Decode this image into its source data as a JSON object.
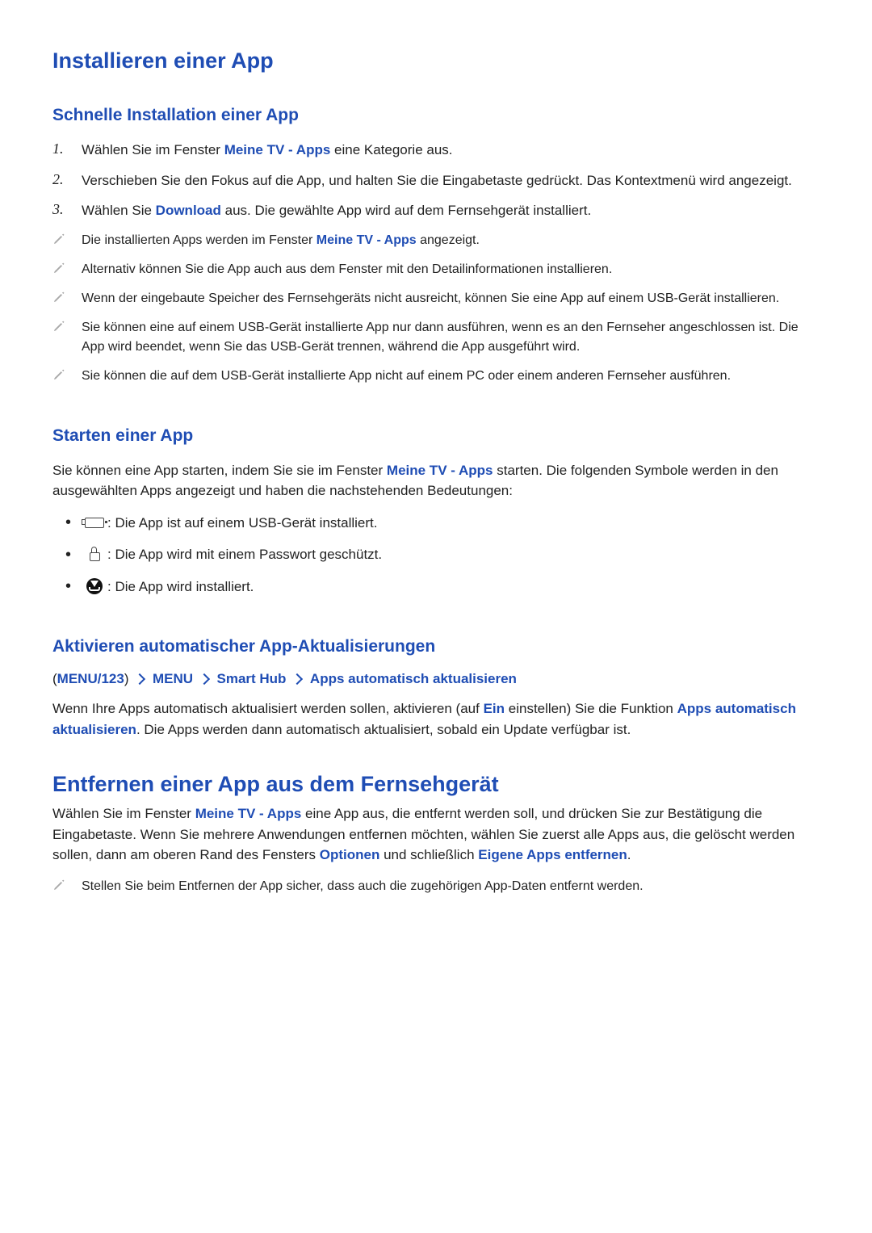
{
  "h1_install": "Installieren einer App",
  "sec_quick": {
    "title": "Schnelle Installation einer App",
    "steps": [
      {
        "num": "1.",
        "pre": "Wählen Sie im Fenster ",
        "link": "Meine TV - Apps",
        "post": " eine Kategorie aus."
      },
      {
        "num": "2.",
        "pre": "Verschieben Sie den Fokus auf die App, und halten Sie die Eingabetaste gedrückt. Das Kontextmenü wird angezeigt.",
        "link": "",
        "post": ""
      },
      {
        "num": "3.",
        "pre": "Wählen Sie ",
        "link": "Download",
        "post": " aus. Die gewählte App wird auf dem Fernsehgerät installiert."
      }
    ],
    "notes": [
      {
        "pre": "Die installierten Apps werden im Fenster ",
        "link": "Meine TV - Apps",
        "post": " angezeigt."
      },
      {
        "pre": "Alternativ können Sie die App auch aus dem Fenster mit den Detailinformationen installieren.",
        "link": "",
        "post": ""
      },
      {
        "pre": "Wenn der eingebaute Speicher des Fernsehgeräts nicht ausreicht, können Sie eine App auf einem USB-Gerät installieren.",
        "link": "",
        "post": ""
      },
      {
        "pre": "Sie können eine auf einem USB-Gerät installierte App nur dann ausführen, wenn es an den Fernseher angeschlossen ist. Die App wird beendet, wenn Sie das USB-Gerät trennen, während die App ausgeführt wird.",
        "link": "",
        "post": ""
      },
      {
        "pre": "Sie können die auf dem USB-Gerät installierte App nicht auf einem PC oder einem anderen Fernseher ausführen.",
        "link": "",
        "post": ""
      }
    ]
  },
  "sec_start": {
    "title": "Starten einer App",
    "intro_pre": "Sie können eine App starten, indem Sie sie im Fenster ",
    "intro_link": "Meine TV - Apps",
    "intro_post": " starten. Die folgenden Symbole werden in den ausgewählten Apps angezeigt und haben die nachstehenden Bedeutungen:",
    "items": [
      {
        "icon": "usb",
        "text": " : Die App ist auf einem USB-Gerät installiert."
      },
      {
        "icon": "lock",
        "text": " : Die App wird mit einem Passwort geschützt."
      },
      {
        "icon": "dl",
        "text": " : Die App wird installiert."
      }
    ]
  },
  "sec_auto": {
    "title": "Aktivieren automatischer App-Aktualisierungen",
    "nav": {
      "open": "(",
      "close": ")",
      "parts": [
        "MENU/123",
        "MENU",
        "Smart Hub",
        "Apps automatisch aktualisieren"
      ]
    },
    "body": {
      "t1": "Wenn Ihre Apps automatisch aktualisiert werden sollen, aktivieren (auf ",
      "l1": "Ein",
      "t2": " einstellen) Sie die Funktion ",
      "l2": "Apps automatisch aktualisieren",
      "t3": ". Die Apps werden dann automatisch aktualisiert, sobald ein Update verfügbar ist."
    }
  },
  "h1_remove": "Entfernen einer App aus dem Fernsehgerät",
  "sec_remove": {
    "body": {
      "t1": "Wählen Sie im Fenster ",
      "l1": "Meine TV - Apps",
      "t2": " eine App aus, die entfernt werden soll, und drücken Sie zur Bestätigung die Eingabetaste. Wenn Sie mehrere Anwendungen entfernen möchten, wählen Sie zuerst alle Apps aus, die gelöscht werden sollen, dann am oberen Rand des Fensters ",
      "l2": "Optionen",
      "t3": " und schließlich ",
      "l3": "Eigene Apps entfernen",
      "t4": "."
    },
    "note": "Stellen Sie beim Entfernen der App sicher, dass auch die zugehörigen App-Daten entfernt werden."
  }
}
